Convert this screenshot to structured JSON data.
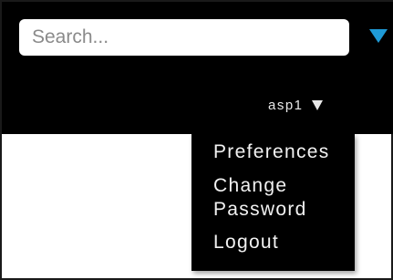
{
  "search": {
    "placeholder": "Search...",
    "value": ""
  },
  "search_dropdown": {
    "icon": "caret-down-icon",
    "color": "#1f9ad6"
  },
  "user_menu": {
    "username": "asp1",
    "icon": "caret-down-icon",
    "items": [
      {
        "label": "Preferences"
      },
      {
        "label_line1": "Change",
        "label_line2": "Password"
      },
      {
        "label": "Logout"
      }
    ]
  },
  "colors": {
    "topbar": "#000000",
    "accent": "#1f9ad6",
    "menu_text": "#f2f2f2",
    "background": "#ffffff"
  }
}
